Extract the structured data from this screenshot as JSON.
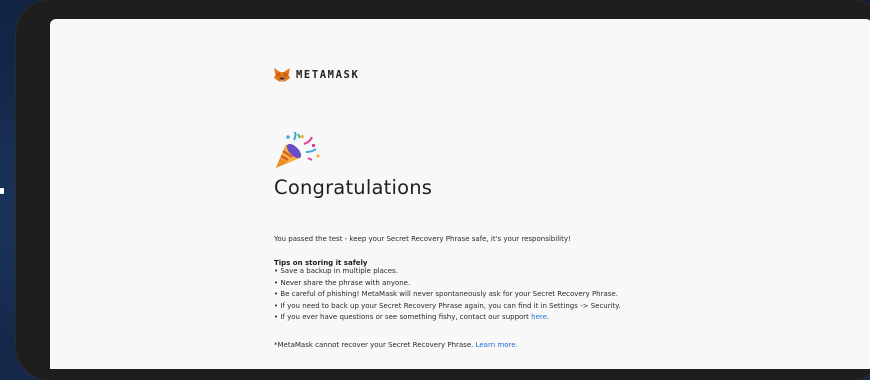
{
  "brand": {
    "name": "METAMASK"
  },
  "main": {
    "title": "Congratulations",
    "intro": "You passed the test - keep your Secret Recovery Phrase safe, it's your responsibility!",
    "tips_heading": "Tips on storing it safely",
    "tips": [
      "• Save a backup in multiple places.",
      "• Never share the phrase with anyone.",
      "• Be careful of phishing! MetaMask will never spontaneously ask for your Secret Recovery Phrase.",
      "• If you need to back up your Secret Recovery Phrase again, you can find it in Settings -> Security."
    ],
    "tip_support_prefix": "• If you ever have questions or see something fishy, contact our support ",
    "tip_support_link": "here",
    "tip_support_suffix": ".",
    "footnote_text": "*MetaMask cannot recover your Secret Recovery Phrase. ",
    "footnote_link": "Learn more."
  },
  "icons": {
    "logo": "metamask-fox-icon",
    "celebration": "party-popper-icon"
  },
  "colors": {
    "background": "#16294a",
    "device_frame": "#1e1e1e",
    "screen": "#f8f8f8",
    "link": "#1e6fd9",
    "text": "#222222"
  }
}
